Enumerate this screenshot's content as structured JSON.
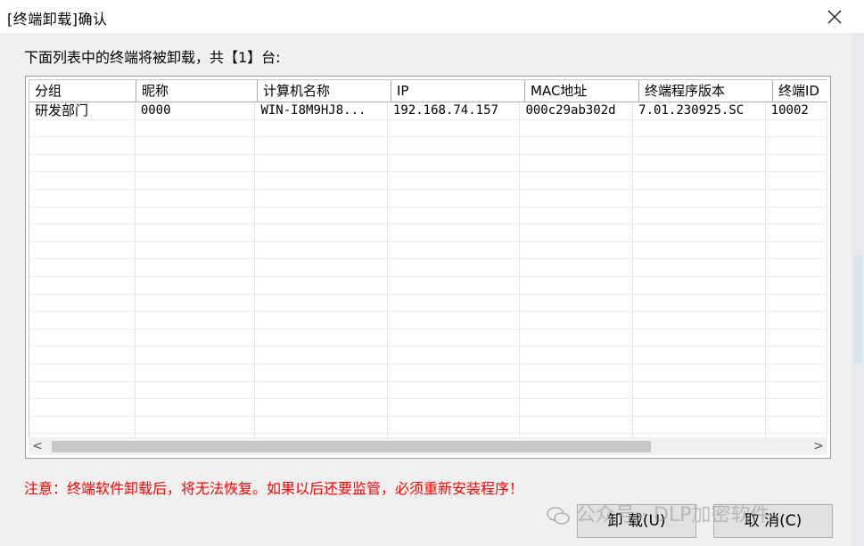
{
  "window": {
    "title": "[终端卸载]确认"
  },
  "dialog": {
    "prompt": "下面列表中的终端将被卸载，共【1】台:",
    "warning": "注意：终端软件卸载后，将无法恢复。如果以后还要监管，必须重新安装程序！"
  },
  "table": {
    "columns": [
      "分组",
      "昵称",
      "计算机名称",
      "IP",
      "MAC地址",
      "终端程序版本",
      "终端ID"
    ],
    "rows": [
      [
        "研发部门",
        "0000",
        "WIN-I8M9HJ8...",
        "192.168.74.157",
        "000c29ab302d",
        "7.01.230925.SC",
        "10002"
      ]
    ]
  },
  "scrollbar": {
    "left_arrow": "<",
    "right_arrow": ">"
  },
  "buttons": {
    "uninstall": "卸 载(U)",
    "cancel": "取 消(C)"
  },
  "watermark": {
    "text": "公众号 · DLP加密软件"
  },
  "icons": {
    "close": "close-icon",
    "watermark": "wechat-icon"
  }
}
